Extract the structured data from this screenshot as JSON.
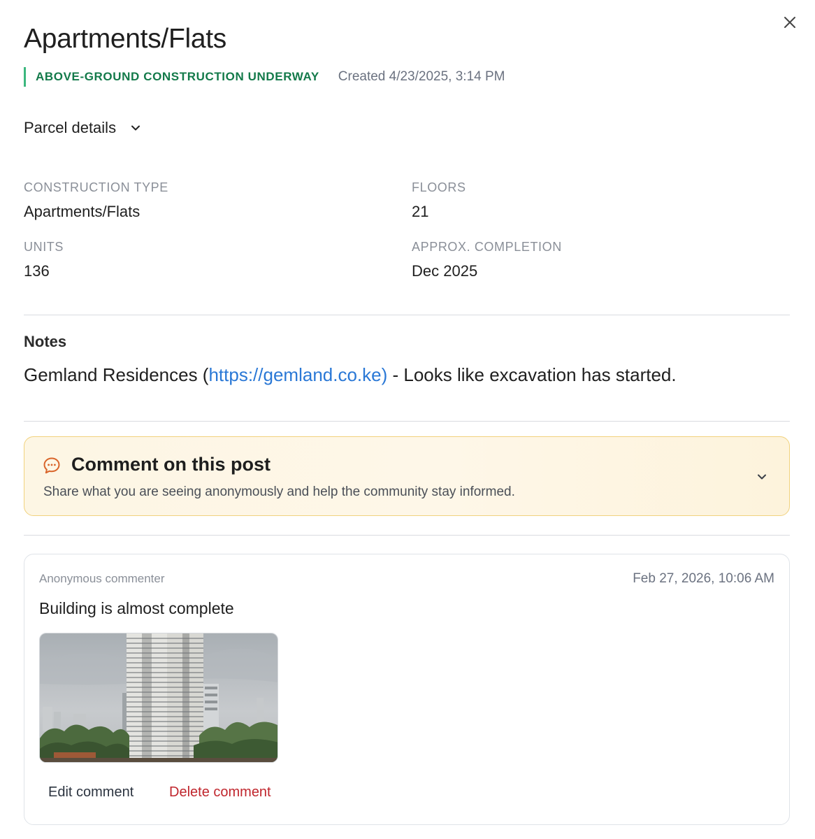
{
  "header": {
    "title": "Apartments/Flats",
    "status_badge": "ABOVE-GROUND CONSTRUCTION UNDERWAY",
    "created": "Created 4/23/2025, 3:14 PM",
    "close_icon": "close-icon"
  },
  "parcel": {
    "toggle_label": "Parcel details",
    "chevron_icon": "chevron-down-icon"
  },
  "details": {
    "construction_type_label": "CONSTRUCTION TYPE",
    "construction_type_value": "Apartments/Flats",
    "floors_label": "FLOORS",
    "floors_value": "21",
    "units_label": "UNITS",
    "units_value": "136",
    "completion_label": "APPROX. COMPLETION",
    "completion_value": "Dec 2025"
  },
  "notes": {
    "heading": "Notes",
    "text_before": "Gemland Residences (",
    "link_text": "https://gemland.co.ke)",
    "text_after": " - Looks like excavation has started."
  },
  "comment_prompt": {
    "heading": "Comment on this post",
    "subtext": "Share what you are seeing anonymously and help the community stay informed.",
    "icon": "chat-bubble-icon",
    "chevron_icon": "chevron-down-icon"
  },
  "comment": {
    "author": "Anonymous commenter",
    "timestamp": "Feb 27, 2026, 10:06 AM",
    "body": "Building is almost complete",
    "edit_label": "Edit comment",
    "delete_label": "Delete comment"
  },
  "colors": {
    "status_green": "#137a4a",
    "status_bar": "#3bb77e",
    "link_blue": "#2a78d6",
    "delete_red": "#c0262d",
    "comment_card_border": "#f1d27e",
    "comment_icon": "#d9652a"
  }
}
